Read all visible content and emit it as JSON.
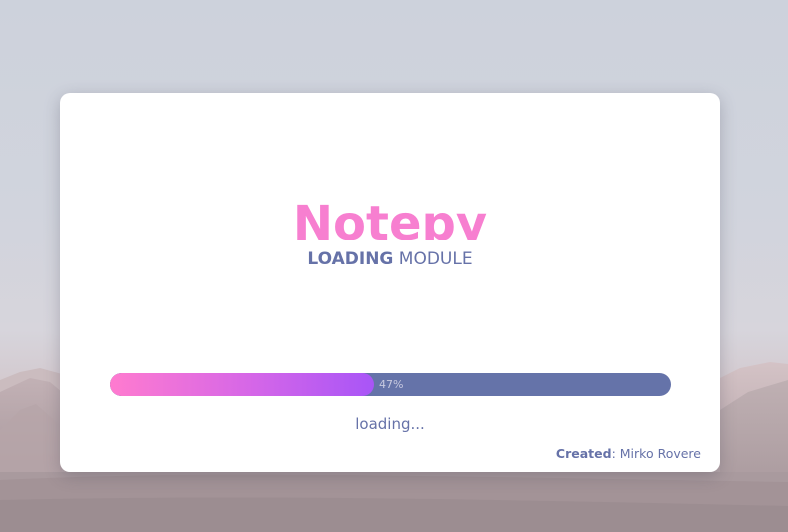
{
  "app": {
    "title": "Notepy",
    "subtitle_strong": "LOADING",
    "subtitle_rest": "MODULE"
  },
  "progress": {
    "value_percent": 47,
    "label": "47%"
  },
  "status": {
    "text": "loading..."
  },
  "credit": {
    "label": "Created",
    "separator": ":",
    "author": "Mirko Rovere"
  },
  "colors": {
    "title": "#f77fd0",
    "text": "#6672a8",
    "track": "#6573a9",
    "fill_start": "#ff7bcf",
    "fill_end": "#a855f7",
    "card": "#ffffff"
  },
  "icons": {
    "background": "desert-dunes-wallpaper"
  }
}
